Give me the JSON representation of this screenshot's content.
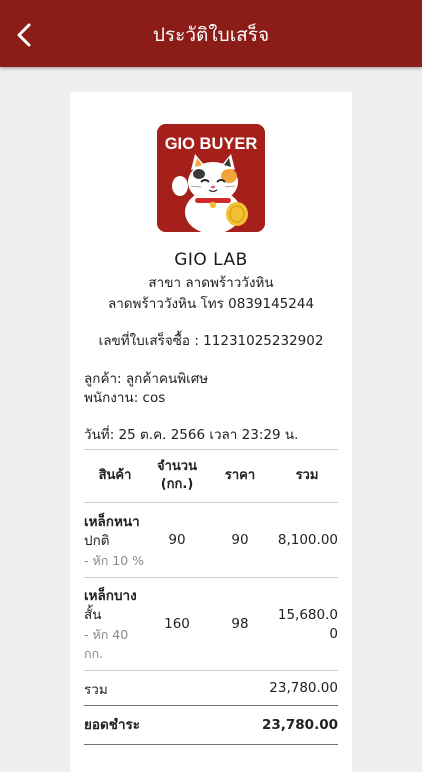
{
  "header": {
    "title": "ประวัติใบเสร็จ",
    "background": "#8b1c17"
  },
  "logo": {
    "text": "GIO BUYER",
    "icon": "maneki-neko-cat-icon"
  },
  "shop": {
    "name": "GIO LAB",
    "branch": "สาขา ลาดพร้าววังหิน",
    "address_phone": "ลาดพร้าววังหิน โทร 0839145244"
  },
  "receipt": {
    "number_line": "เลขที่ใบเสร็จซื้อ : 11231025232902",
    "customer_line": "ลูกค้า: ลูกค้าคนพิเศษ",
    "staff_line": "พนักงาน: cos",
    "date_line": "วันที่: 25 ต.ค. 2566 เวลา 23:29 น."
  },
  "table": {
    "headers": {
      "product": "สินค้า",
      "qty_line1": "จำนวน",
      "qty_line2": "(กก.)",
      "price": "ราคา",
      "total": "รวม"
    },
    "rows": [
      {
        "name_bold": "เหล็กหนา",
        "name_rest": "ปกติ",
        "note": "- หัก 10 %",
        "qty": "90",
        "price": "90",
        "total": "8,100.00"
      },
      {
        "name_bold": "เหล็กบาง",
        "name_rest": "สั้น",
        "note": "- หัก 40 กก.",
        "qty": "160",
        "price": "98",
        "total": "15,680.00"
      }
    ],
    "subtotal_label": "รวม",
    "subtotal_value": "23,780.00",
    "grand_label": "ยอดชำระ",
    "grand_value": "23,780.00"
  }
}
